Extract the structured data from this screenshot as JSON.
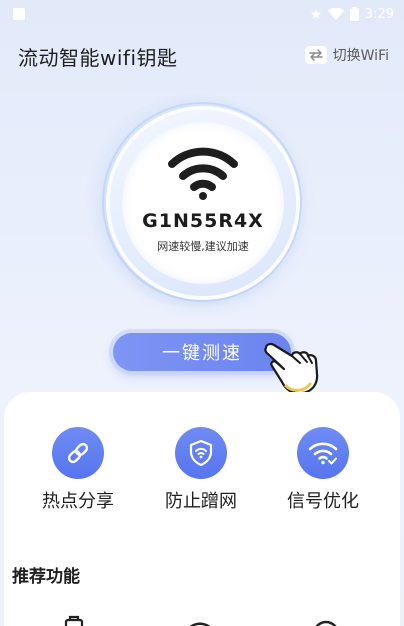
{
  "status_bar": {
    "time": "3:29",
    "icons": [
      "notification-square-icon",
      "star-icon",
      "wifi-signal-icon",
      "battery-icon"
    ]
  },
  "header": {
    "title": "流动智能wifi钥匙",
    "switch_label": "切换WiFi",
    "switch_icon": "swap-icon"
  },
  "network": {
    "ssid": "G1N55R4X",
    "status": "网速较慢,建议加速",
    "icon": "wifi-icon"
  },
  "speed_test": {
    "label": "一键测速",
    "hint_icon": "pointing-hand-icon"
  },
  "features": [
    {
      "label": "热点分享",
      "icon": "link-icon"
    },
    {
      "label": "防止蹭网",
      "icon": "shield-wifi-icon"
    },
    {
      "label": "信号优化",
      "icon": "wifi-check-icon"
    }
  ],
  "recommended": {
    "title": "推荐功能"
  },
  "colors": {
    "accent": "#6a83f0",
    "feature_icon_bg": "#5f7cf0",
    "background": "#e9effc"
  }
}
